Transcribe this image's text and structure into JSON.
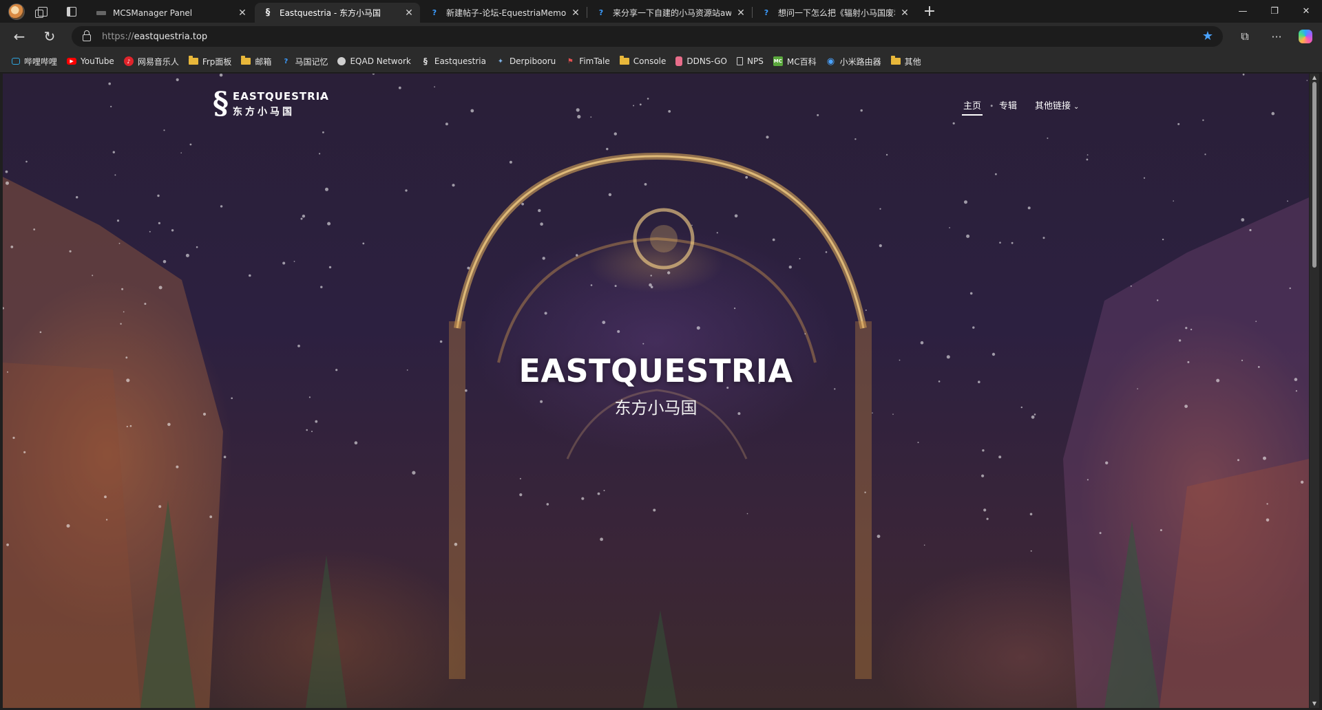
{
  "tabs": [
    {
      "label": "MCSManager Panel",
      "favicon": "mcsmanager-icon"
    },
    {
      "label": "Eastquestria - 东方小马国",
      "favicon": "eastquestria-icon",
      "active": true
    },
    {
      "label": "新建帖子-论坛-EquestriaMemory",
      "favicon": "forum-icon"
    },
    {
      "label": "来分享一下自建的小马资源站awa",
      "favicon": "forum-icon"
    },
    {
      "label": "想问一下怎么把《辐射小马国废墟",
      "favicon": "forum-icon"
    }
  ],
  "address_bar": {
    "scheme": "https://",
    "host": "eastquestria.top"
  },
  "bookmarks": [
    {
      "label": "哔哩哔哩",
      "icon": "bilibili-icon"
    },
    {
      "label": "YouTube",
      "icon": "youtube-icon"
    },
    {
      "label": "网易音乐人",
      "icon": "netease-icon"
    },
    {
      "label": "Frp面板",
      "icon": "folder-icon"
    },
    {
      "label": "邮箱",
      "icon": "folder-icon"
    },
    {
      "label": "马国记忆",
      "icon": "forum-icon"
    },
    {
      "label": "EQAD Network",
      "icon": "circle-icon"
    },
    {
      "label": "Eastquestria",
      "icon": "eastquestria-icon"
    },
    {
      "label": "Derpibooru",
      "icon": "derpibooru-icon"
    },
    {
      "label": "FimTale",
      "icon": "fimtale-icon"
    },
    {
      "label": "Console",
      "icon": "folder-icon"
    },
    {
      "label": "DDNS-GO",
      "icon": "ddns-icon"
    },
    {
      "label": "NPS",
      "icon": "page-icon"
    },
    {
      "label": "MC百科",
      "icon": "mc-icon"
    },
    {
      "label": "小米路由器",
      "icon": "wifi-icon"
    },
    {
      "label": "其他",
      "icon": "folder-icon"
    }
  ],
  "site": {
    "logo_en": "EASTQUESTRIA",
    "logo_cn": "东方小马国",
    "nav": {
      "home": "主页",
      "albums": "专辑",
      "other_links": "其他链接"
    },
    "hero_title": "EASTQUESTRIA",
    "hero_subtitle": "东方小马国"
  },
  "colors": {
    "accent": "#4aa3ff",
    "tab_active": "#2b2b2b",
    "tab_strip": "#1b1b1b"
  }
}
